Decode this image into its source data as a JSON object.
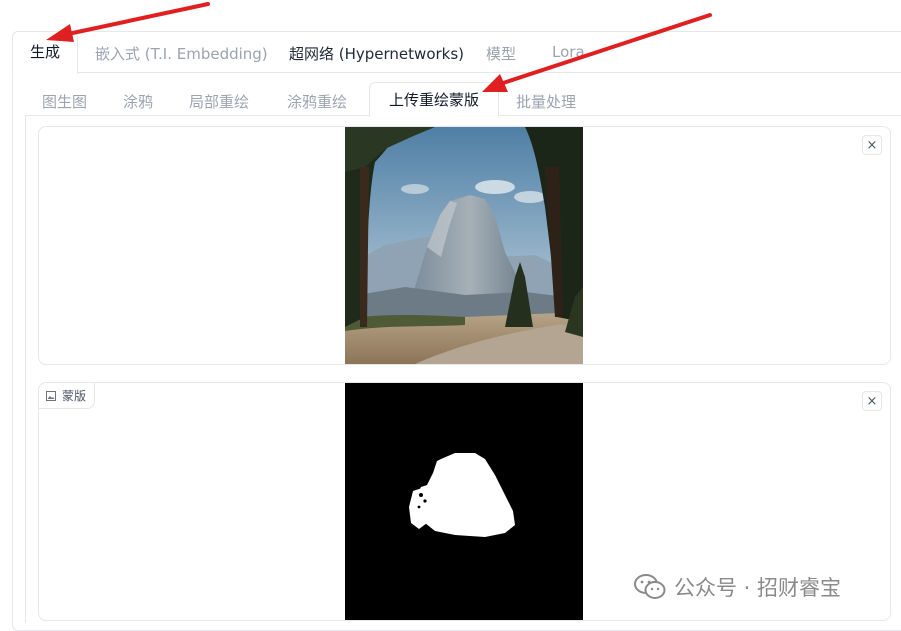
{
  "top_tabs": [
    {
      "label": "生成",
      "active": true
    },
    {
      "label": "嵌入式 (T.I. Embedding)",
      "active": false
    },
    {
      "label": "超网络 (Hypernetworks)",
      "active": false
    },
    {
      "label": "模型",
      "active": false
    },
    {
      "label": "Lora",
      "active": false
    }
  ],
  "sub_tabs": [
    {
      "label": "图生图",
      "active": false
    },
    {
      "label": "涂鸦",
      "active": false
    },
    {
      "label": "局部重绘",
      "active": false
    },
    {
      "label": "涂鸦重绘",
      "active": false
    },
    {
      "label": "上传重绘蒙版",
      "active": true
    },
    {
      "label": "批量处理",
      "active": false
    }
  ],
  "image_box": {
    "close": "×"
  },
  "mask_box": {
    "label": "蒙版",
    "close": "×"
  },
  "watermark": {
    "text": "公众号 · 招财睿宝"
  },
  "annotation_color": "#e02020"
}
